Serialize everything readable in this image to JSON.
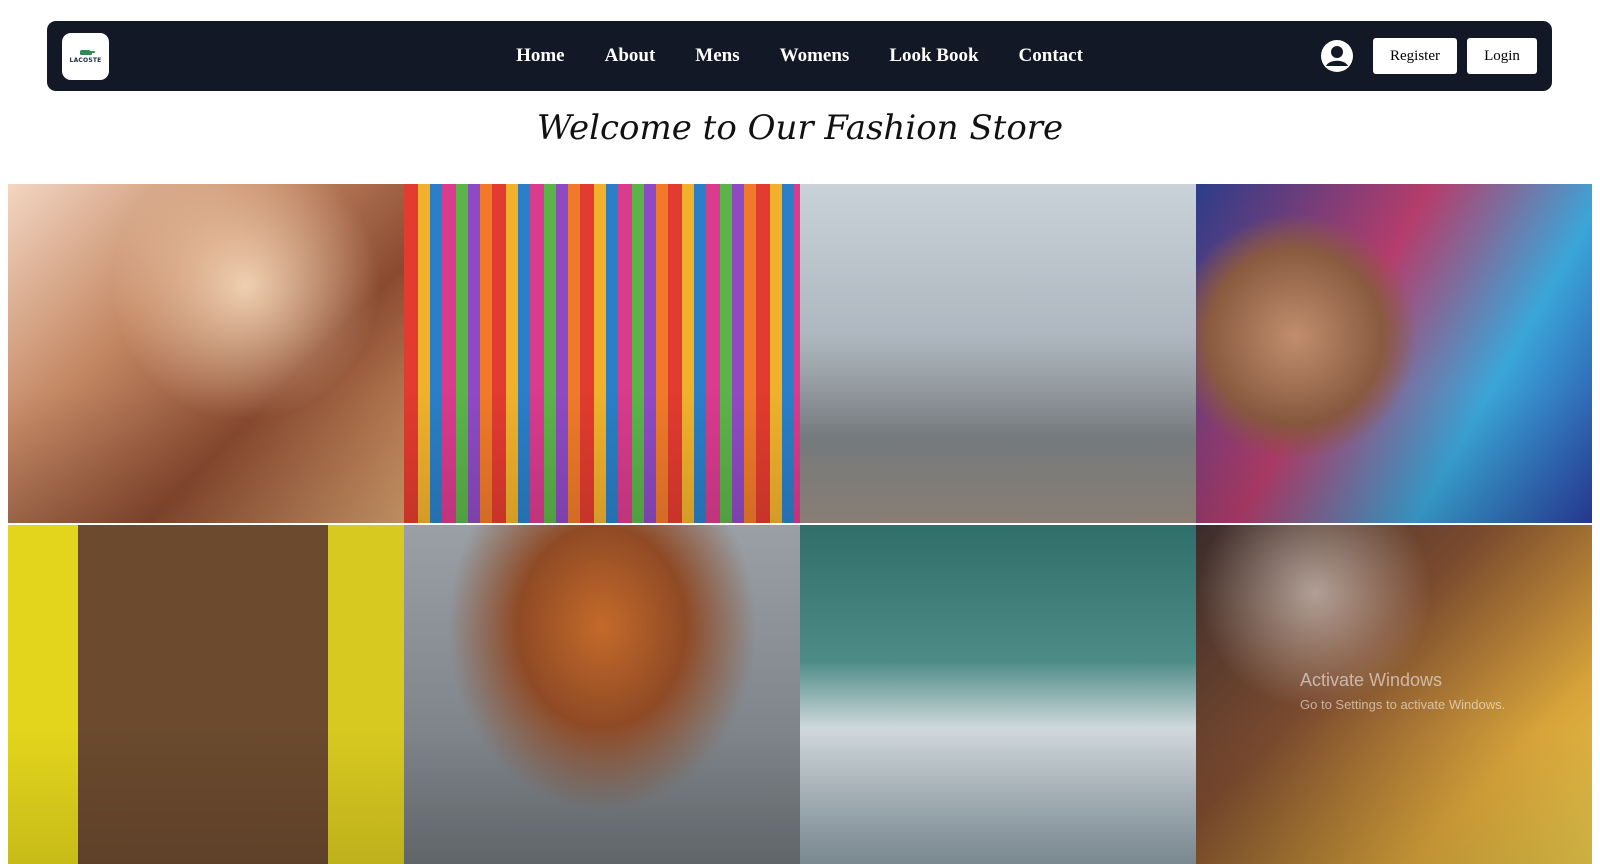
{
  "navbar": {
    "logo_text": "LACOSTE",
    "links": [
      "Home",
      "About",
      "Mens",
      "Womens",
      "Look Book",
      "Contact"
    ],
    "user_icon": "user-circle-icon",
    "register_label": "Register",
    "login_label": "Login",
    "background_color": "#121826"
  },
  "hero": {
    "title": "Welcome to Our Fashion Store"
  },
  "gallery": {
    "images": [
      "women-blowing-confetti-photo",
      "woman-walking-colorful-stripes-photo",
      "couple-dancing-rooftop-photo",
      "woman-graffiti-wall-photo",
      "smiling-man-apron-photo",
      "hair-flip-couple-photo",
      "woman-denim-jacket-walking-photo",
      "girls-dancing-party-photo"
    ]
  },
  "watermark": {
    "line1": "Activate Windows",
    "line2": "Go to Settings to activate Windows."
  }
}
